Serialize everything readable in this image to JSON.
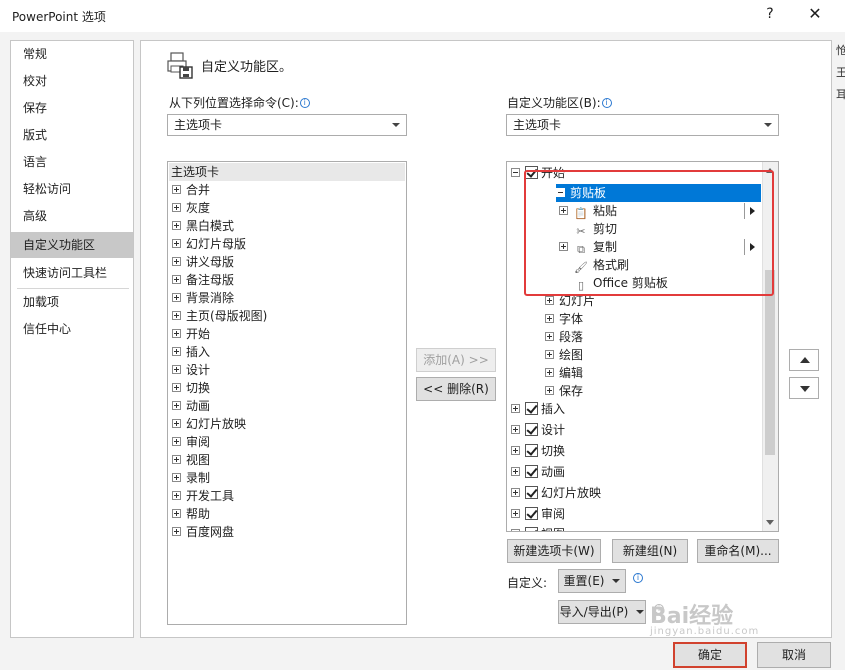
{
  "window": {
    "title": "PowerPoint 选项",
    "help": "?",
    "close": "✕"
  },
  "right_edge_text": "怆\n王\n耳",
  "nav": {
    "items": [
      {
        "label": "常规"
      },
      {
        "label": "校对"
      },
      {
        "label": "保存"
      },
      {
        "label": "版式"
      },
      {
        "label": "语言"
      },
      {
        "label": "轻松访问"
      },
      {
        "label": "高级"
      },
      {
        "label": "自定义功能区"
      },
      {
        "label": "快速访问工具栏"
      },
      {
        "label": "加载项"
      },
      {
        "label": "信任中心"
      }
    ],
    "active": "自定义功能区"
  },
  "header": {
    "title": "自定义功能区。",
    "icon": "customize-ribbon-icon"
  },
  "left_panel": {
    "label": "从下列位置选择命令(C):",
    "combo_value": "主选项卡",
    "list_header": "主选项卡",
    "items": [
      "合并",
      "灰度",
      "黑白模式",
      "幻灯片母版",
      "讲义母版",
      "备注母版",
      "背景消除",
      "主页(母版视图)",
      "开始",
      "插入",
      "设计",
      "切换",
      "动画",
      "幻灯片放映",
      "审阅",
      "视图",
      "录制",
      "开发工具",
      "帮助",
      "百度网盘"
    ]
  },
  "middle_buttons": {
    "add": "添加(A) >>",
    "remove": "<< 删除(R)"
  },
  "right_panel": {
    "label": "自定义功能区(B):",
    "combo_value": "主选项卡",
    "tree": {
      "start": "开始",
      "clipboard": "剪贴板",
      "clipboard_items": [
        {
          "label": "粘贴",
          "icon": "paste-icon",
          "expandable": true,
          "split": true
        },
        {
          "label": "剪切",
          "icon": "scissors-icon",
          "expandable": false,
          "split": false
        },
        {
          "label": "复制",
          "icon": "copy-icon",
          "expandable": true,
          "split": true
        },
        {
          "label": "格式刷",
          "icon": "format-painter-icon",
          "expandable": false,
          "split": false
        },
        {
          "label": "Office 剪贴板",
          "icon": "office-clipboard-icon",
          "expandable": false,
          "split": false
        }
      ],
      "groups": [
        "幻灯片",
        "字体",
        "段落",
        "绘图",
        "编辑",
        "保存"
      ],
      "tabs": [
        "插入",
        "设计",
        "切换",
        "动画",
        "幻灯片放映",
        "审阅",
        "视图"
      ]
    },
    "new_tab": "新建选项卡(W)",
    "new_group": "新建组(N)",
    "rename": "重命名(M)...",
    "customize_label": "自定义:",
    "reset": "重置(E)",
    "import_export": "导入/导出(P)"
  },
  "footer": {
    "ok": "确定",
    "cancel": "取消"
  },
  "watermark": {
    "brand": "Bai经验",
    "url": "jingyan.baidu.com"
  },
  "colors": {
    "selection": "#0078d7",
    "highlight_box": "#e23b3b",
    "ok_border": "#d1422e"
  }
}
